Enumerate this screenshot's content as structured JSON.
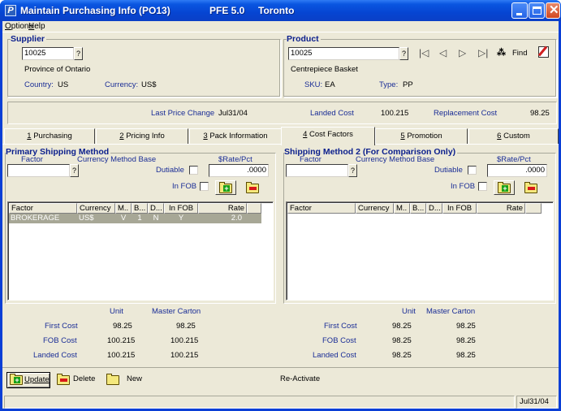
{
  "window": {
    "title": "Maintain Purchasing Info (PO13)",
    "version": "PFE 5.0",
    "location": "Toronto",
    "app_icon_letter": "P"
  },
  "menu": {
    "items": [
      {
        "label": "Options",
        "accel": "O"
      },
      {
        "label": "Help",
        "accel": "H"
      }
    ]
  },
  "supplier": {
    "title": "Supplier",
    "code": "10025",
    "lookup_label": "?",
    "name": "Province of Ontario",
    "country_label": "Country:",
    "country": "US",
    "currency_label": "Currency:",
    "currency": "US$"
  },
  "product": {
    "title": "Product",
    "code": "10025",
    "lookup_label": "?",
    "name": "Centrepiece Basket",
    "sku_label": "SKU:",
    "sku": "EA",
    "type_label": "Type:",
    "type": "PP",
    "nav": {
      "first": "|◁",
      "prev": "◁",
      "next": "▷",
      "last": "▷|",
      "find_label": "Find",
      "find_icon": "binoculars-icon",
      "edit_icon": "edit-note-icon"
    }
  },
  "price_summary": {
    "last_price_change_label": "Last Price Change",
    "last_price_change": "Jul31/04",
    "landed_cost_label": "Landed Cost",
    "landed_cost": "100.215",
    "replacement_cost_label": "Replacement Cost",
    "replacement_cost": "98.25"
  },
  "tabs": [
    {
      "num": "1",
      "label": "Purchasing",
      "active": false
    },
    {
      "num": "2",
      "label": "Pricing Info",
      "active": false
    },
    {
      "num": "3",
      "label": "Pack Information",
      "active": false
    },
    {
      "num": "4",
      "label": "Cost Factors",
      "active": true
    },
    {
      "num": "5",
      "label": "Promotion",
      "active": false
    },
    {
      "num": "6",
      "label": "Custom",
      "active": false
    }
  ],
  "primary": {
    "title": "Primary Shipping Method",
    "factor_label": "Factor",
    "factor_value": "",
    "lookup_label": "?",
    "currency_method_base_label": "Currency  Method Base",
    "rate_label": "$Rate/Pct",
    "rate_value": ".0000",
    "dutiable_label": "Dutiable",
    "dutiable_checked": false,
    "infob_label": "In FOB",
    "infob_checked": false,
    "columns": [
      "Factor",
      "Currency",
      "M..",
      "B...",
      "D...",
      "In FOB",
      "Rate"
    ],
    "rows": [
      {
        "factor": "BROKERAGE",
        "currency": "US$",
        "m": "V",
        "b": "1",
        "d": "N",
        "infob": "Y",
        "rate": "2.0"
      }
    ],
    "totals": {
      "unit_label": "Unit",
      "carton_label": "Master Carton",
      "first_cost_label": "First Cost",
      "first_cost_unit": "98.25",
      "first_cost_carton": "98.25",
      "fob_cost_label": "FOB Cost",
      "fob_cost_unit": "100.215",
      "fob_cost_carton": "100.215",
      "landed_cost_label": "Landed Cost",
      "landed_cost_unit": "100.215",
      "landed_cost_carton": "100.215"
    }
  },
  "secondary": {
    "title": "Shipping Method 2 (For Comparison Only)",
    "factor_label": "Factor",
    "factor_value": "",
    "lookup_label": "?",
    "currency_method_base_label": "Currency  Method Base",
    "rate_label": "$Rate/Pct",
    "rate_value": ".0000",
    "dutiable_label": "Dutiable",
    "dutiable_checked": false,
    "infob_label": "In FOB",
    "infob_checked": false,
    "columns": [
      "Factor",
      "Currency",
      "M..",
      "B...",
      "D...",
      "In FOB",
      "Rate"
    ],
    "rows": [],
    "totals": {
      "unit_label": "Unit",
      "carton_label": "Master Carton",
      "first_cost_label": "First Cost",
      "first_cost_unit": "98.25",
      "first_cost_carton": "98.25",
      "fob_cost_label": "FOB Cost",
      "fob_cost_unit": "98.25",
      "fob_cost_carton": "98.25",
      "landed_cost_label": "Landed Cost",
      "landed_cost_unit": "98.25",
      "landed_cost_carton": "98.25"
    }
  },
  "actions": {
    "update": "Update",
    "delete": "Delete",
    "new": "New",
    "reactivate": "Re-Activate"
  },
  "status": {
    "message": "",
    "date": "Jul31/04"
  },
  "colors": {
    "title_bar": "#0645d2",
    "label_blue": "#1a2d96",
    "selected_row": "#a7a796",
    "face": "#ece9d8"
  }
}
